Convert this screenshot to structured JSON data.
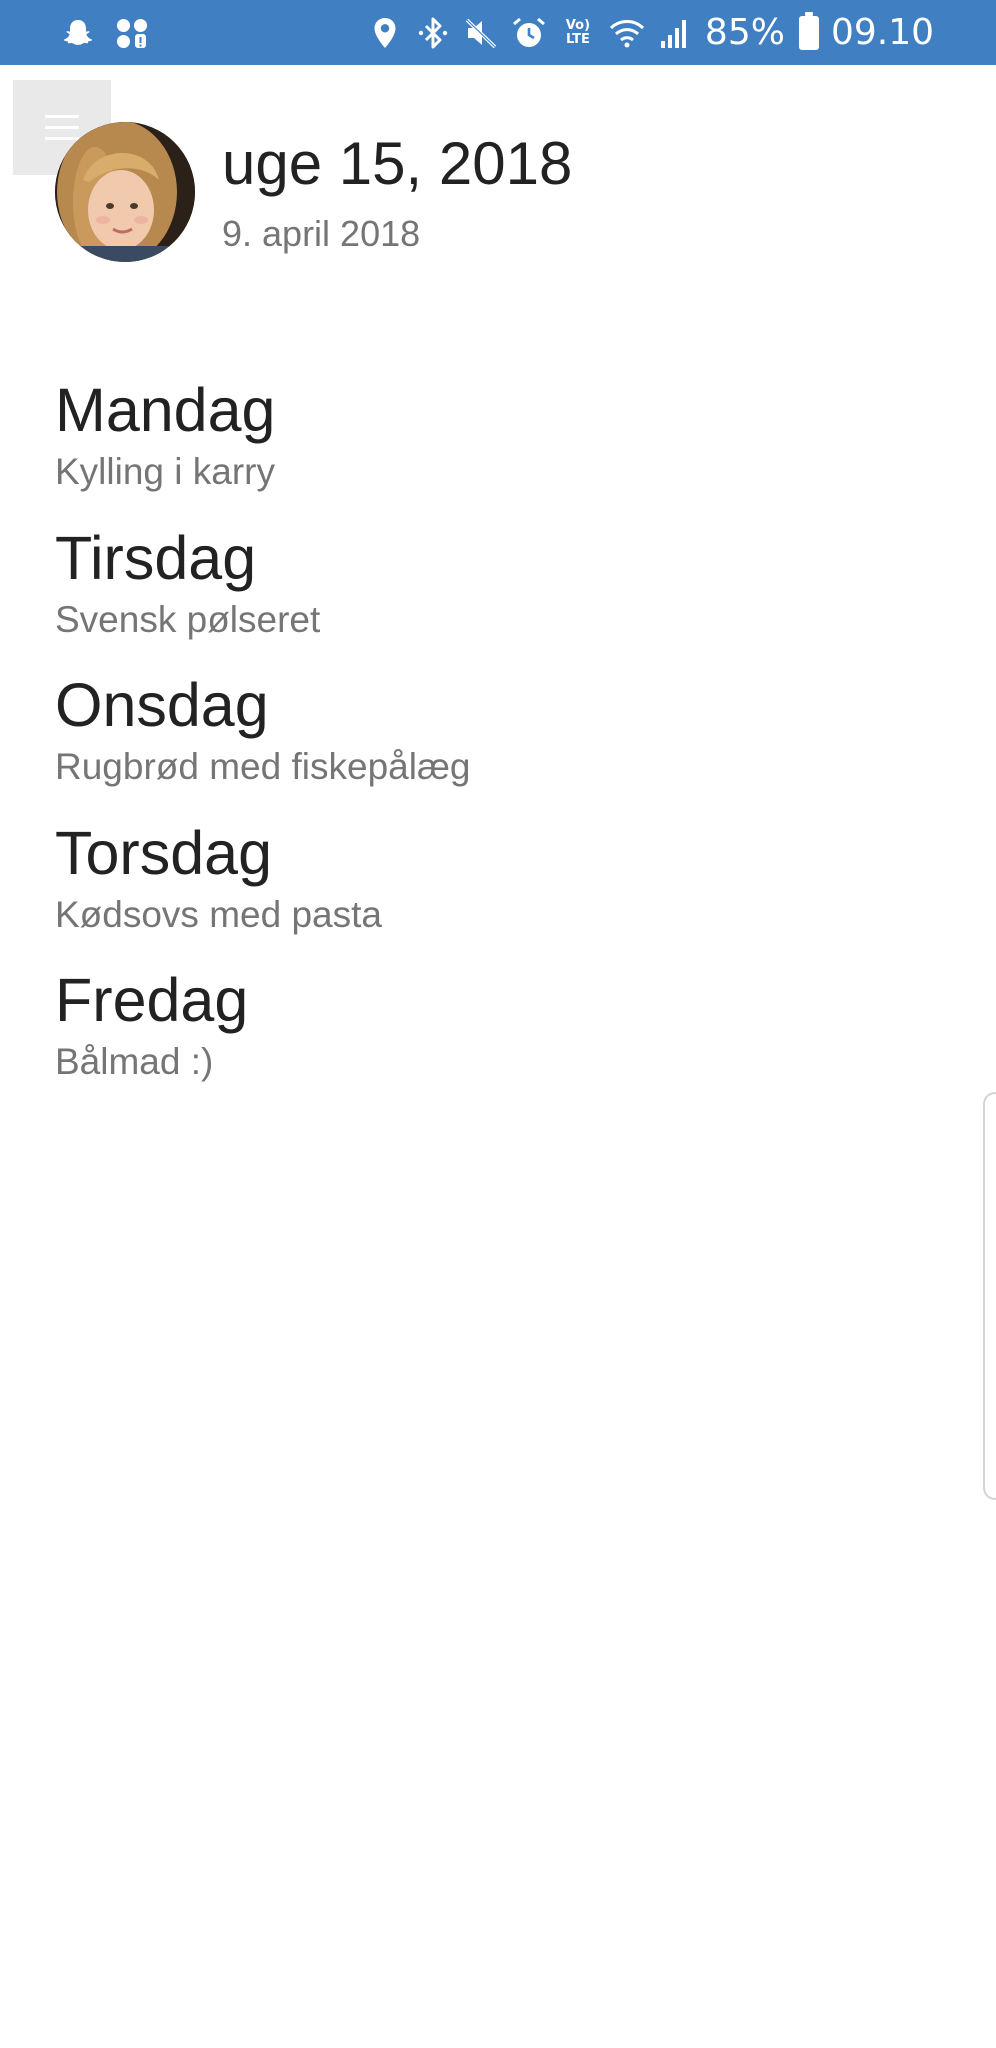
{
  "status_bar": {
    "battery": "85%",
    "time": "09.10",
    "volte": "Vo) LTE",
    "left_icons": [
      "snapchat-icon",
      "notification-icon"
    ],
    "right_icons": [
      "location-icon",
      "bluetooth-icon",
      "mute-icon",
      "alarm-icon",
      "volte-icon",
      "wifi-icon",
      "signal-icon",
      "battery-icon"
    ]
  },
  "header": {
    "title": "uge 15, 2018",
    "date": "9. april 2018"
  },
  "days": [
    {
      "name": "Mandag",
      "meal": "Kylling i karry"
    },
    {
      "name": "Tirsdag",
      "meal": "Svensk pølseret"
    },
    {
      "name": "Onsdag",
      "meal": "Rugbrød med fiskepålæg"
    },
    {
      "name": "Torsdag",
      "meal": "Kødsovs med pasta"
    },
    {
      "name": "Fredag",
      "meal": "Bålmad :)"
    }
  ],
  "colors": {
    "status_bar": "#3f7fc2",
    "primary_text": "#222222",
    "secondary_text": "#757575",
    "menu_button_bg": "#e9e9e9"
  }
}
